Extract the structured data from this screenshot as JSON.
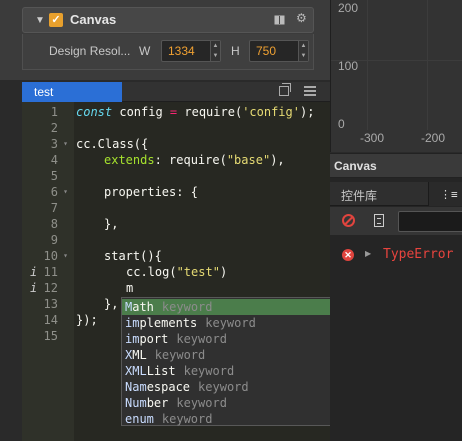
{
  "inspector": {
    "component_title": "Canvas",
    "design_resolution_label": "Design Resol...",
    "width_label": "W",
    "width_value": "1334",
    "height_label": "H",
    "height_value": "750"
  },
  "editor_tab": {
    "label": "test"
  },
  "code": {
    "lines": [
      {
        "n": "1",
        "info": "",
        "fold": false
      },
      {
        "n": "2",
        "info": "",
        "fold": false
      },
      {
        "n": "3",
        "info": "",
        "fold": true
      },
      {
        "n": "4",
        "info": "",
        "fold": false
      },
      {
        "n": "5",
        "info": "",
        "fold": false
      },
      {
        "n": "6",
        "info": "",
        "fold": true
      },
      {
        "n": "7",
        "info": "",
        "fold": false
      },
      {
        "n": "8",
        "info": "",
        "fold": false
      },
      {
        "n": "9",
        "info": "",
        "fold": false
      },
      {
        "n": "10",
        "info": "",
        "fold": true
      },
      {
        "n": "11",
        "info": "i",
        "fold": false
      },
      {
        "n": "12",
        "info": "i",
        "fold": false
      },
      {
        "n": "13",
        "info": "",
        "fold": false
      },
      {
        "n": "14",
        "info": "",
        "fold": false
      },
      {
        "n": "15",
        "info": "",
        "fold": false
      }
    ],
    "line1": {
      "const": "const",
      "rest1": " config ",
      "eq": "=",
      "rest2": " require(",
      "str": "'config'",
      "rest3": ");"
    },
    "line3": "cc.Class({",
    "line4": {
      "key": "extends",
      "rest1": ": require(",
      "str": "\"base\"",
      "rest2": "),"
    },
    "line6": "properties: {",
    "line8": "},",
    "line10": "start(){",
    "line11": {
      "pre": "cc.log(",
      "str": "\"test\"",
      "post": ")"
    },
    "line12": "m",
    "line13": "},",
    "line14": "});"
  },
  "autocomplete": {
    "items": [
      {
        "match": "M",
        "rest": "ath",
        "meta": "keyword"
      },
      {
        "match": "im",
        "rest": "plements",
        "meta": "keyword"
      },
      {
        "match": "im",
        "rest": "port",
        "meta": "keyword"
      },
      {
        "match": "X",
        "rest": "ML",
        "meta": "keyword"
      },
      {
        "match": "XML",
        "rest": "List",
        "meta": "keyword"
      },
      {
        "match": "Nam",
        "rest": "espace",
        "meta": "keyword"
      },
      {
        "match": "Num",
        "rest": "ber",
        "meta": "keyword"
      },
      {
        "match": "enum",
        "rest": "",
        "meta": "keyword"
      }
    ]
  },
  "scene_ruler": {
    "y_ticks": [
      "200",
      "100",
      "0"
    ],
    "x_ticks": [
      "-300",
      "-200"
    ]
  },
  "canvas_panel": {
    "title": "Canvas"
  },
  "console": {
    "widgets_tab": "控件库",
    "console_tab_icon": "⋮≡",
    "filter_value": "",
    "error_text": "TypeError"
  },
  "colors": {
    "accent_orange": "#f0a132",
    "tab_blue": "#2b6fd6",
    "selection_green": "#4b7d4b",
    "error_red": "#e8443e"
  }
}
